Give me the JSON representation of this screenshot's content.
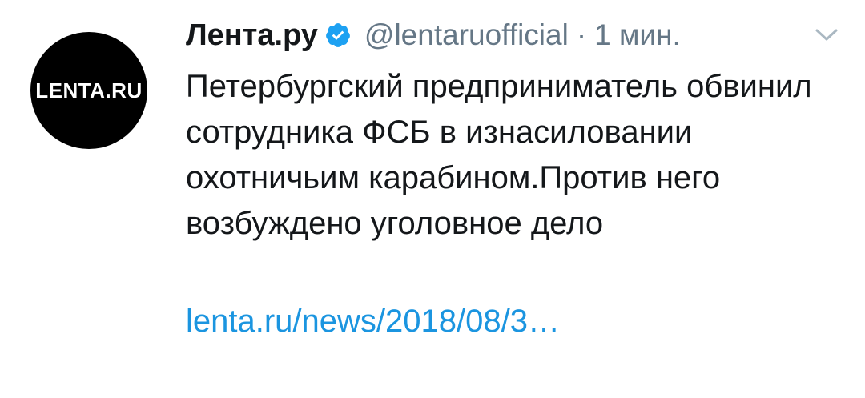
{
  "author": {
    "avatar_logo_text": "LENTA.RU",
    "display_name": "Лента.ру",
    "handle": "@lentaruofficial",
    "separator": "·",
    "time": "1 мин."
  },
  "tweet": {
    "text": "Петербургский предприниматель обвинил сотрудника ФСБ в изнасиловании охотничьим карабином.Против него возбуждено уголовное дело",
    "link": "lenta.ru/news/2018/08/3…"
  },
  "icons": {
    "verified": "verified-badge-icon",
    "caret": "chevron-down-icon"
  },
  "colors": {
    "verified_blue": "#1da1f2",
    "link_blue": "#1b95e0",
    "secondary_text": "#657786",
    "primary_text": "#14171a",
    "avatar_bg": "#000000"
  }
}
